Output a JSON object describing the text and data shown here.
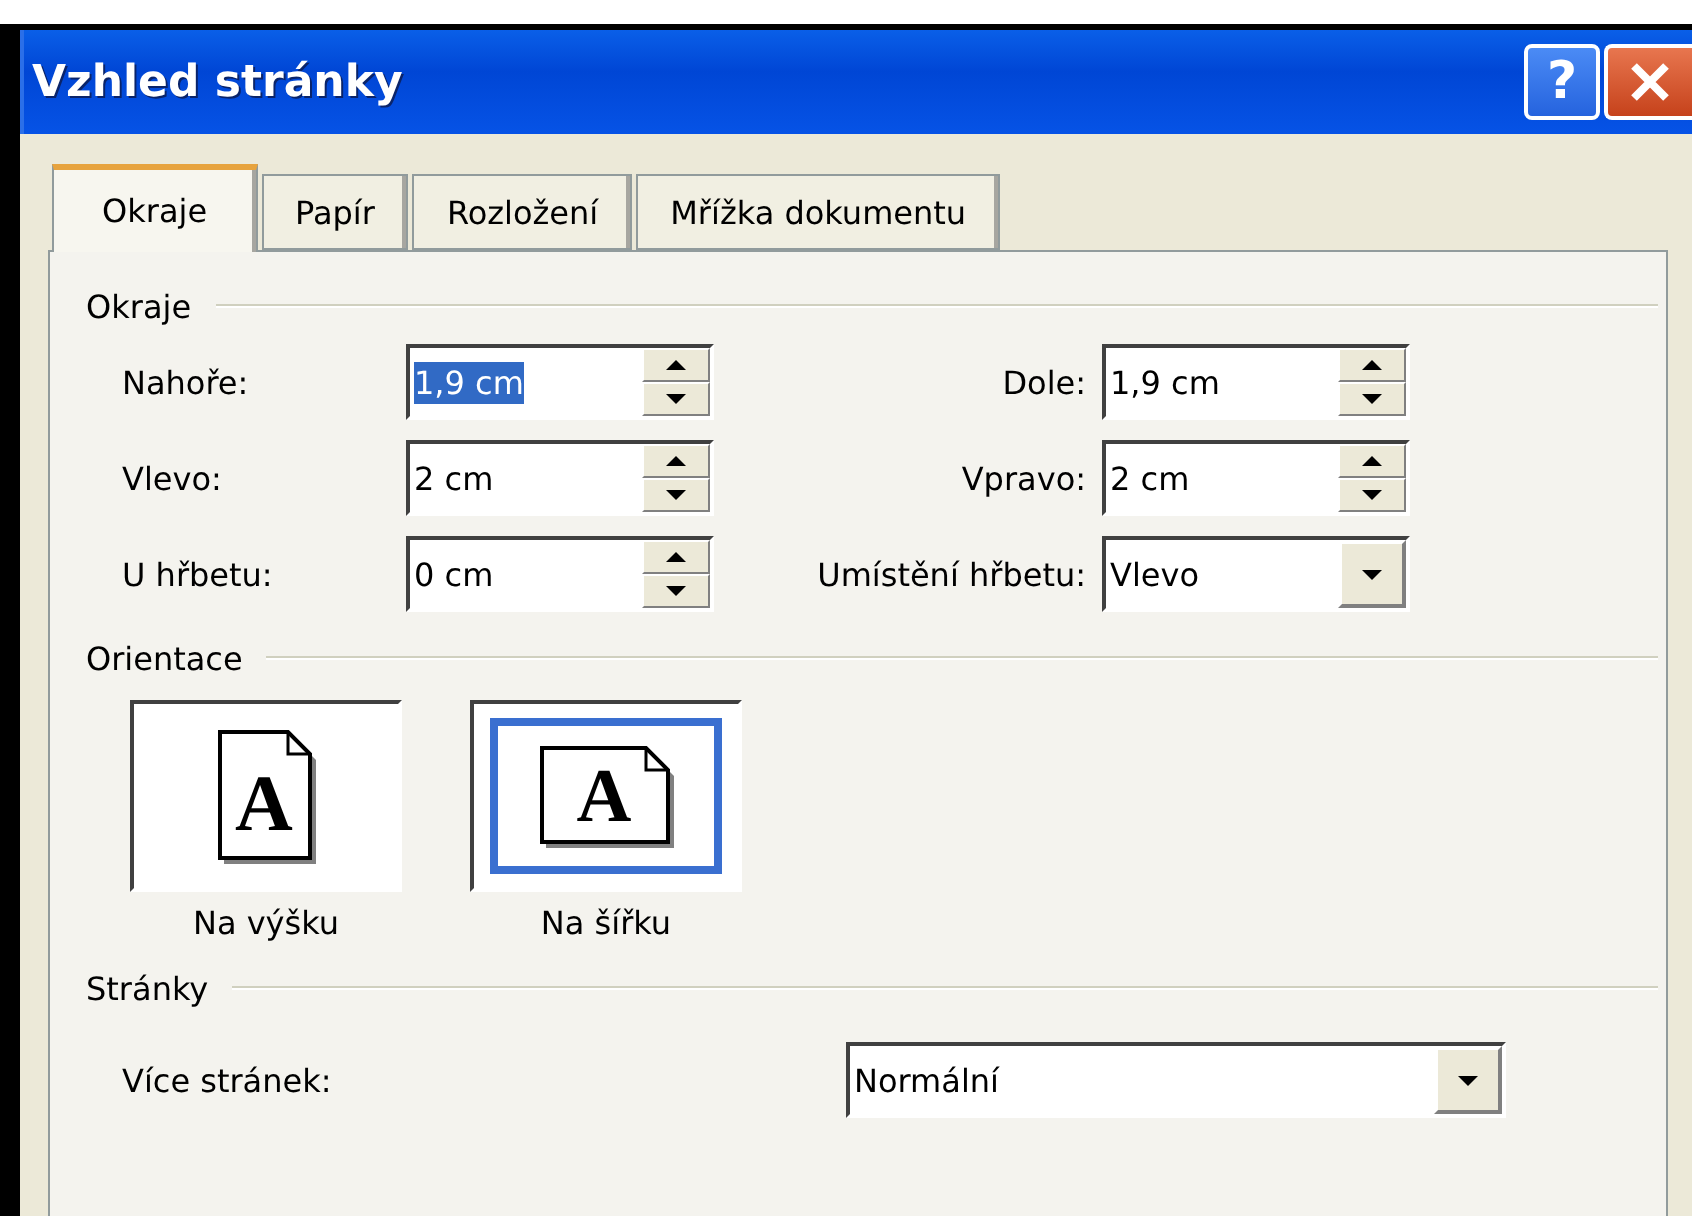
{
  "window": {
    "title": "Vzhled stránky",
    "help_button": "?"
  },
  "tabs": [
    {
      "label": "Okraje",
      "selected": true
    },
    {
      "label": "Papír",
      "selected": false
    },
    {
      "label": "Rozložení",
      "selected": false
    },
    {
      "label": "Mřížka dokumentu",
      "selected": false
    }
  ],
  "margins": {
    "title": "Okraje",
    "rows": [
      {
        "left": {
          "label": "Nahoře:",
          "value": "1,9 cm",
          "kind": "spin",
          "text_selected": true
        },
        "right": {
          "label": "Dole:",
          "value": "1,9 cm",
          "kind": "spin",
          "text_selected": false
        }
      },
      {
        "left": {
          "label": "Vlevo:",
          "value": "2 cm",
          "kind": "spin",
          "text_selected": false
        },
        "right": {
          "label": "Vpravo:",
          "value": "2 cm",
          "kind": "spin",
          "text_selected": false
        }
      },
      {
        "left": {
          "label": "U hřbetu:",
          "value": "0 cm",
          "kind": "spin",
          "text_selected": false
        },
        "right": {
          "label": "Umístění hřbetu:",
          "value": "Vlevo",
          "kind": "dropdown",
          "text_selected": false
        }
      }
    ]
  },
  "orientation": {
    "title": "Orientace",
    "options": [
      {
        "label": "Na výšku",
        "glyph": "A",
        "kind": "portrait",
        "selected": false
      },
      {
        "label": "Na šířku",
        "glyph": "A",
        "kind": "landscape",
        "selected": true
      }
    ]
  },
  "pages": {
    "title": "Stránky",
    "multiple_pages": {
      "label": "Více stránek:",
      "value": "Normální"
    }
  }
}
